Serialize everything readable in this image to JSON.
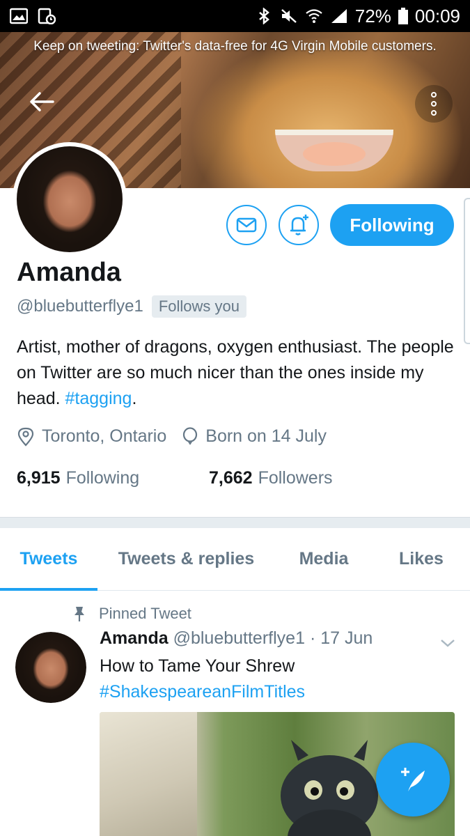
{
  "status_bar": {
    "battery": "72%",
    "time": "00:09",
    "icons": [
      "gallery-icon",
      "image-notification-icon",
      "bluetooth-icon",
      "mute-icon",
      "wifi-icon",
      "signal-icon",
      "battery-icon"
    ]
  },
  "banner": {
    "promo_text": "Keep on tweeting: Twitter's data-free for 4G Virgin Mobile customers."
  },
  "profile": {
    "name": "Amanda",
    "handle": "@bluebutterflye1",
    "follows_you": "Follows you",
    "bio_text": "Artist, mother of dragons, oxygen enthusiast. The people on Twitter are so much nicer than the ones inside my head. ",
    "bio_hashtag": "#tagging",
    "bio_end": ".",
    "location": "Toronto, Ontario",
    "birthday": "Born on 14 July",
    "following_count": "6,915",
    "following_label": "Following",
    "followers_count": "7,662",
    "followers_label": "Followers"
  },
  "actions": {
    "following_button": "Following"
  },
  "tabs": [
    {
      "label": "Tweets",
      "active": true
    },
    {
      "label": "Tweets & replies",
      "active": false
    },
    {
      "label": "Media",
      "active": false
    },
    {
      "label": "Likes",
      "active": false
    }
  ],
  "pinned_tweet": {
    "pinned_label": "Pinned Tweet",
    "author_name": "Amanda",
    "author_handle": "@bluebutterflye1",
    "date": "· 17 Jun",
    "text": "How to Tame Your Shrew",
    "hashtag": "#ShakespeareanFilmTitles"
  },
  "colors": {
    "accent": "#1da1f2",
    "text": "#14171a",
    "muted": "#657786"
  }
}
